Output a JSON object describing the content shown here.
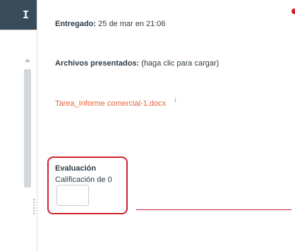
{
  "toolbar": {
    "icon_glyph": "I",
    "icon_name": "collapse-panel-icon"
  },
  "submission": {
    "submitted_label": "Entregado:",
    "submitted_value": "25 de mar en 21:06",
    "files_label": "Archivos presentados:",
    "files_hint": "(haga clic para cargar)",
    "file_name": "Tarea_Informe comercial-1.docx",
    "download_glyph": "↓"
  },
  "evaluation": {
    "title": "Evaluación",
    "grade_text": "Calificación de 0",
    "grade_value": ""
  },
  "colors": {
    "accent": "#e66135",
    "highlight": "#d2202f",
    "toolbar": "#394b58"
  }
}
